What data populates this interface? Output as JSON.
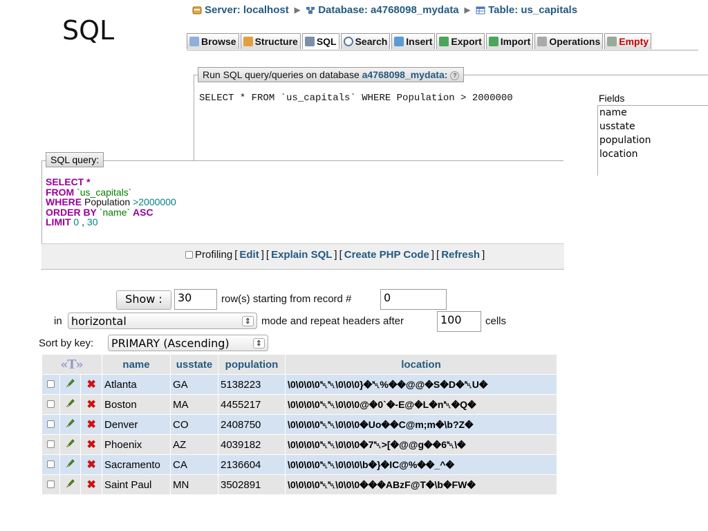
{
  "slide": {
    "title": "SQL"
  },
  "breadcrumb": {
    "server": "Server: localhost",
    "database": "Database: a4768098_mydata",
    "table": "Table: us_capitals"
  },
  "tabs": [
    {
      "label": "Browse",
      "icon": "browse-icon"
    },
    {
      "label": "Structure",
      "icon": "structure-icon"
    },
    {
      "label": "SQL",
      "icon": "sql-icon"
    },
    {
      "label": "Search",
      "icon": "search-icon"
    },
    {
      "label": "Insert",
      "icon": "insert-icon"
    },
    {
      "label": "Export",
      "icon": "export-icon"
    },
    {
      "label": "Import",
      "icon": "import-icon"
    },
    {
      "label": "Operations",
      "icon": "operations-icon"
    },
    {
      "label": "Empty",
      "icon": "empty-icon"
    }
  ],
  "run_sql": {
    "legend_prefix": "Run SQL query/queries on database",
    "db_name": "a4768098_mydata:",
    "query_text": "SELECT * FROM `us_capitals` WHERE Population > 2000000",
    "fields_label": "Fields",
    "fields": [
      "name",
      "usstate",
      "population",
      "location"
    ]
  },
  "sql_query": {
    "legend": "SQL query:",
    "select_kw": "SELECT",
    "select_rest": " *",
    "from_kw": "FROM",
    "from_table": " `us_capitals`",
    "where_kw": "WHERE",
    "where_col": " Population ",
    "where_op": ">",
    "where_val": "2000000",
    "order_kw": "ORDER BY",
    "order_col": " `name` ",
    "order_dir": "ASC",
    "limit_kw": "LIMIT",
    "limit_a": " 0",
    "limit_sep": " , ",
    "limit_b": "30",
    "profiling_label": "Profiling",
    "edit_link": "Edit",
    "explain_link": "Explain SQL",
    "php_link": "Create PHP Code",
    "refresh_link": "Refresh"
  },
  "nav": {
    "show_button": "Show :",
    "rows_value": "30",
    "rows_text": "row(s) starting from record #",
    "start_value": "0",
    "in_text": "in",
    "mode_value": "horizontal",
    "mode_text": "mode and repeat headers after",
    "repeat_value": "100",
    "cells_text": "cells",
    "sort_label": "Sort by key:",
    "sort_value": "PRIMARY (Ascending)"
  },
  "table": {
    "sort_toggle": "«T»",
    "columns": [
      "name",
      "usstate",
      "population",
      "location"
    ],
    "rows": [
      {
        "name": "Atlanta",
        "usstate": "GA",
        "population": "5138223",
        "location": "\\0\\0\\0\\0␀␀\\0\\0\\0}�␀%��@@�S�D�␀U�"
      },
      {
        "name": "Boston",
        "usstate": "MA",
        "population": "4455217",
        "location": "\\0\\0\\0\\0␀␀\\0\\0\\0@�0`�-E@�L�n␀�Q�"
      },
      {
        "name": "Denver",
        "usstate": "CO",
        "population": "2408750",
        "location": "\\0\\0\\0\\0␀␀\\0\\0\\0�Uo��C@m;m�\\b?Z�"
      },
      {
        "name": "Phoenix",
        "usstate": "AZ",
        "population": "4039182",
        "location": "\\0\\0\\0\\0␀␀\\0\\0\\0�7␀>[�@@ɡ��6␀\\�"
      },
      {
        "name": "Sacramento",
        "usstate": "CA",
        "population": "2136604",
        "location": "\\0\\0\\0\\0␀␀\\0\\0\\0\\b�}�IC@%��_^�"
      },
      {
        "name": "Saint Paul",
        "usstate": "MN",
        "population": "3502891",
        "location": "\\0\\0\\0\\0␀␀\\0\\0\\0���ABzF@T�\\b�FW�"
      }
    ]
  },
  "colors": {
    "link": "#235a81",
    "keyword": "#990099",
    "string": "#008000",
    "row_even": "#d5e2f1",
    "row_odd": "#e5e5e5",
    "delete": "#d01010"
  }
}
